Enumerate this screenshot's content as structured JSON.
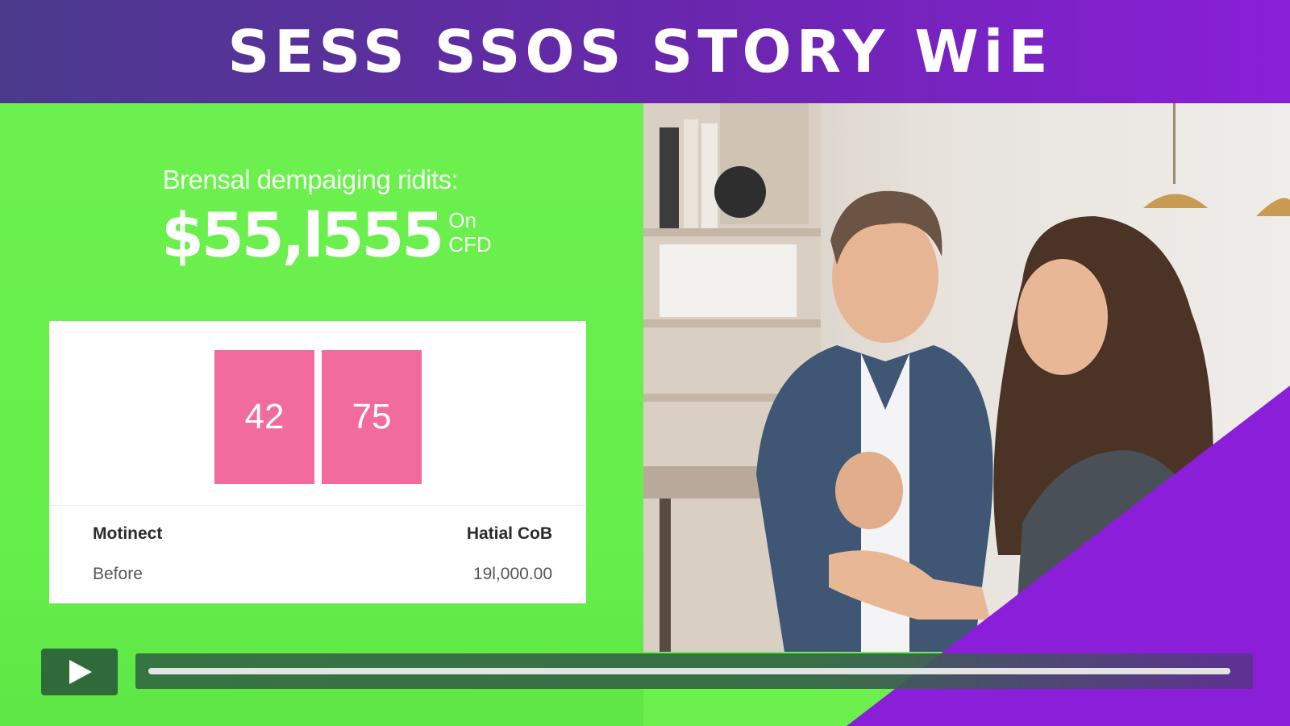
{
  "header": {
    "title": "SESS SSOS STORY WiE"
  },
  "stat": {
    "label": "Brensal dempaiging ridits:",
    "value": "$55,l555",
    "suffix_top": "On",
    "suffix_bottom": "CFD"
  },
  "card": {
    "bars": [
      {
        "label": "42"
      },
      {
        "label": "75"
      }
    ],
    "table": {
      "headers": [
        "Motinect",
        "Hatial CoB"
      ],
      "rows": [
        [
          "Before",
          "19l,000.00"
        ]
      ]
    }
  },
  "player": {
    "play_icon": "play-icon",
    "progress": 1.0
  },
  "colors": {
    "green_panel": "#6cf04e",
    "banner_purple": "#6a26ae",
    "accent_purple": "#8a1fd8",
    "bar_pink": "#f26b9f",
    "play_green": "#2f6a3b"
  }
}
